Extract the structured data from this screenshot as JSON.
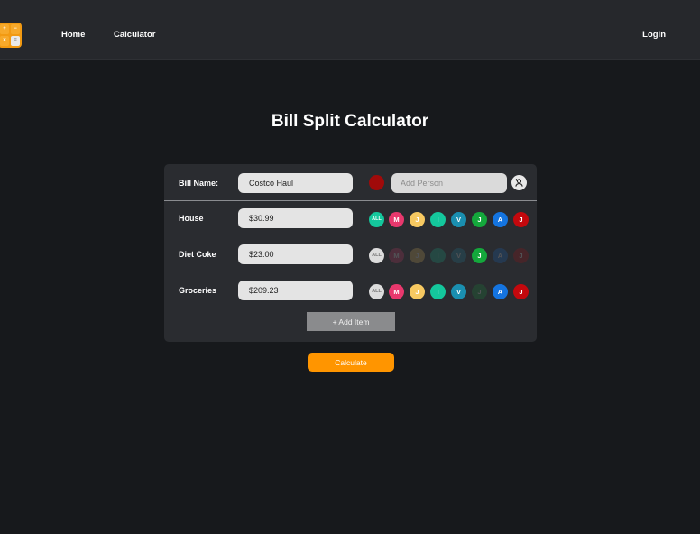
{
  "nav": {
    "logo_keys": [
      "+",
      "−",
      "×",
      "="
    ],
    "home": "Home",
    "calculator": "Calculator",
    "login": "Login"
  },
  "title": "Bill Split Calculator",
  "bill": {
    "label": "Bill Name:",
    "value": "Costco Haul",
    "color": "#a00a0a",
    "person_placeholder": "Add Person"
  },
  "people": [
    {
      "initial": "M",
      "color": "#e8386d"
    },
    {
      "initial": "J",
      "color": "#f7c961"
    },
    {
      "initial": "I",
      "color": "#14c79c"
    },
    {
      "initial": "V",
      "color": "#1a8fb0"
    },
    {
      "initial": "J",
      "color": "#14a83c"
    },
    {
      "initial": "A",
      "color": "#1474e0"
    },
    {
      "initial": "J",
      "color": "#c3080d"
    }
  ],
  "all_label": "ALL",
  "items": [
    {
      "name": "House",
      "price": "$30.99",
      "all_active": true,
      "active": [
        true,
        true,
        true,
        true,
        true,
        true,
        true
      ]
    },
    {
      "name": "Diet Coke",
      "price": "$23.00",
      "all_active": false,
      "active": [
        false,
        false,
        false,
        false,
        true,
        false,
        false
      ]
    },
    {
      "name": "Groceries",
      "price": "$209.23",
      "all_active": false,
      "active": [
        true,
        true,
        true,
        true,
        false,
        true,
        true
      ]
    }
  ],
  "add_item": "+ Add Item",
  "calculate": "Calculate"
}
